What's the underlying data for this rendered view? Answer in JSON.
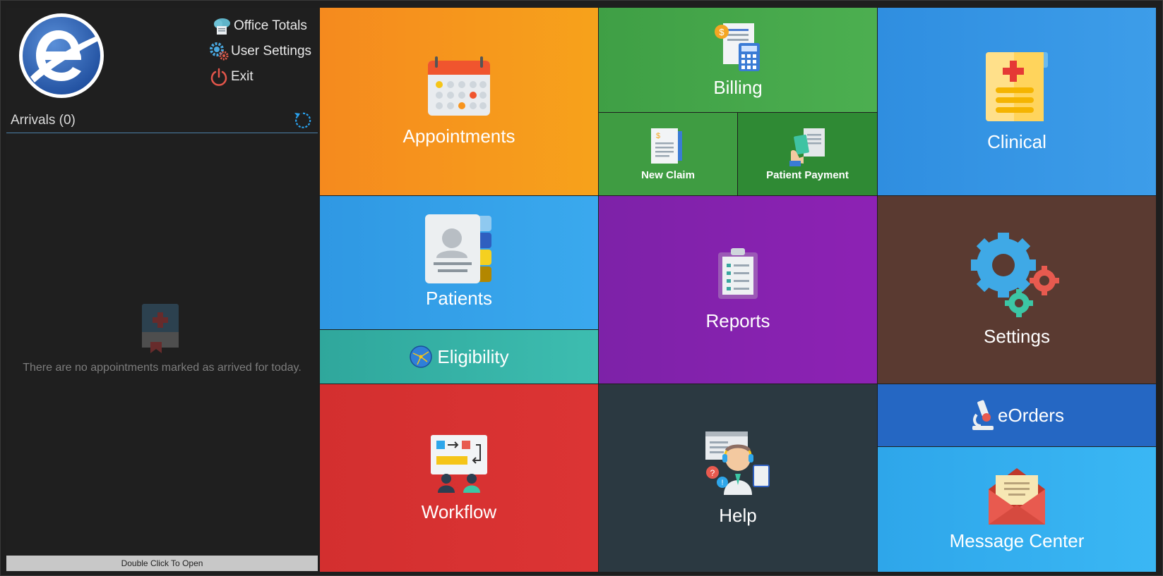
{
  "top_links": [
    {
      "label": "Office Totals",
      "icon": "cloud-docs-icon"
    },
    {
      "label": "User Settings",
      "icon": "user-gear-icon"
    },
    {
      "label": "Exit",
      "icon": "power-icon"
    }
  ],
  "arrivals": {
    "title": "Arrivals (0)",
    "empty_message": "There are no appointments marked as arrived for today.",
    "footer": "Double Click To Open"
  },
  "tiles": {
    "appointments": "Appointments",
    "billing": "Billing",
    "new_claim": "New Claim",
    "patient_payment": "Patient Payment",
    "clinical": "Clinical",
    "patients": "Patients",
    "eligibility": "Eligibility",
    "reports": "Reports",
    "settings": "Settings",
    "workflow": "Workflow",
    "help": "Help",
    "eorders": "eOrders",
    "message_center": "Message Center"
  },
  "colors": {
    "appointments": "#f7941d",
    "billing": "#4caf50",
    "clinical": "#3594e5",
    "patients": "#36a3ea",
    "eligibility": "#37b3a7",
    "reports": "#8a22b0",
    "settings": "#5a3a31",
    "workflow": "#d83131",
    "help": "#2b3941",
    "eorders": "#2567c3",
    "message_center": "#35b0ef",
    "accent": "#2aa3f0"
  }
}
